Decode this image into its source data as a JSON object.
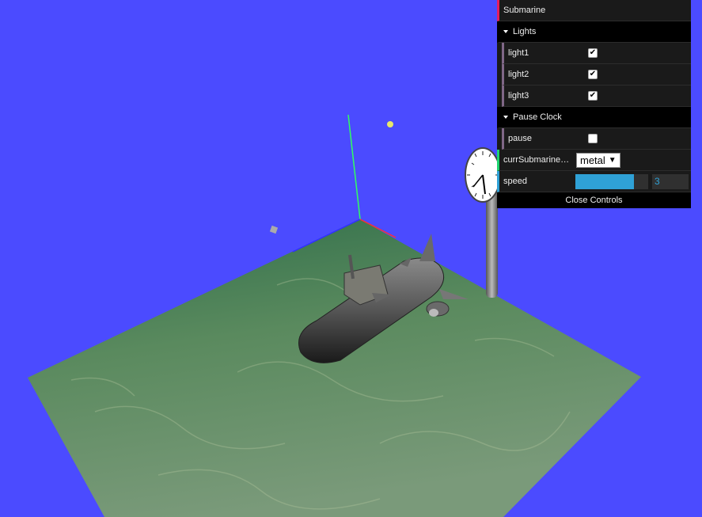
{
  "gui": {
    "root_label": "Submarine",
    "lights_folder": "Lights",
    "light1_label": "light1",
    "light1_checked": true,
    "light2_label": "light2",
    "light2_checked": true,
    "light3_label": "light3",
    "light3_checked": true,
    "pause_folder": "Pause Clock",
    "pause_label": "pause",
    "pause_checked": false,
    "appearance_label": "currSubmarineA…",
    "appearance_value": "metal",
    "speed_label": "speed",
    "speed_value": "3",
    "speed_fraction": 0.8,
    "close_label": "Close Controls"
  },
  "scene": {
    "background_color": "#4b4bff",
    "floor_color": "#3f7a55",
    "axis_colors": {
      "x": "#ff3030",
      "y": "#30ff60",
      "z": "#3030ff"
    }
  }
}
